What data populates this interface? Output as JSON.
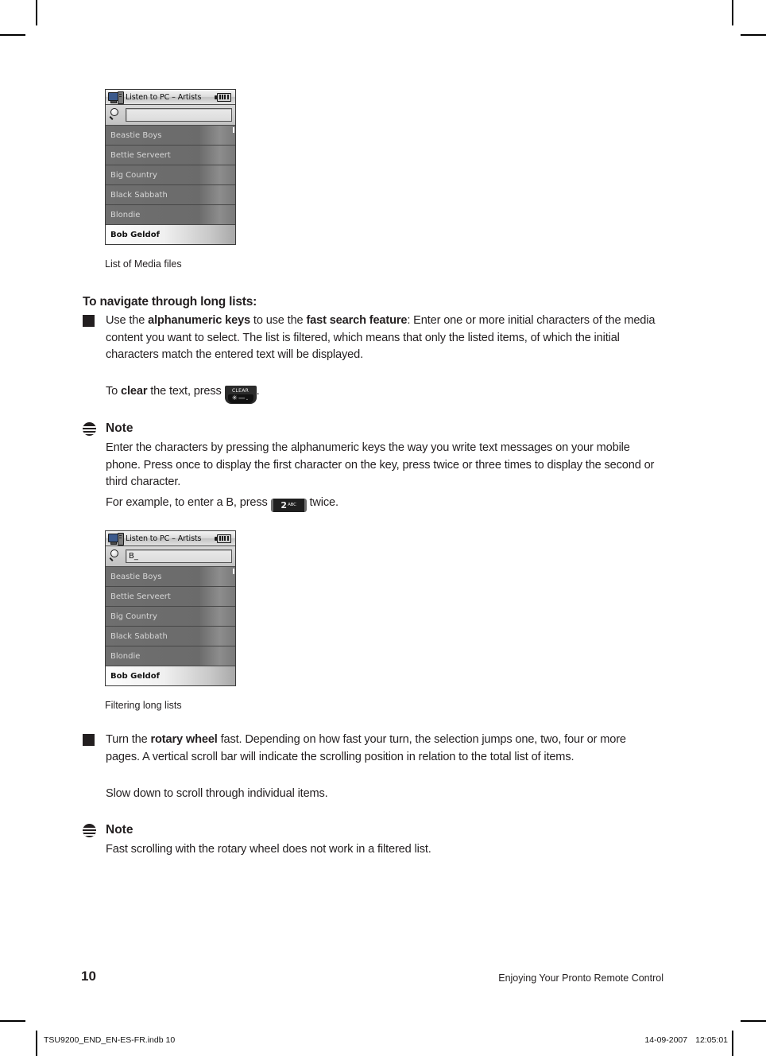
{
  "page": {
    "number": "10",
    "running_head": "Enjoying Your Pronto Remote Control",
    "slug_file": "TSU9200_END_EN-ES-FR.indb   10",
    "slug_date": "14-09-2007",
    "slug_time": "12:05:01"
  },
  "screenshot_1": {
    "title": "Listen to PC – Artists",
    "search_value": "",
    "items": [
      "Beastie Boys",
      "Bettie Serveert",
      "Big Country",
      "Black Sabbath",
      "Blondie",
      "Bob Geldof"
    ],
    "selected_item": "Bob Geldof",
    "caption": "List of Media files"
  },
  "screenshot_2": {
    "title": "Listen to PC – Artists",
    "search_value": "B_",
    "items": [
      "Beastie Boys",
      "Bettie Serveert",
      "Big Country",
      "Black Sabbath",
      "Blondie",
      "Bob Geldof"
    ],
    "selected_item": "Bob Geldof",
    "caption": "Filtering long lists"
  },
  "section": {
    "heading": "To navigate through long lists:"
  },
  "bullet_1": {
    "part_1": "Use the ",
    "bold_1": "alphanumeric keys",
    "part_2": " to use the ",
    "bold_2": "fast search feature",
    "part_3": ": Enter one or more initial characters of the media content you want to select. The list is filtered, which means that only the listed items, of which the initial characters match the entered text will be displayed.",
    "clear_line_pre": "To ",
    "clear_line_bold": "clear",
    "clear_line_mid": " the text, press ",
    "clear_line_post": "."
  },
  "key_clear": {
    "label": "CLEAR",
    "glyphs": "✳—."
  },
  "key_two": {
    "number": "2",
    "letters": "ABC"
  },
  "note_1": {
    "label": "Note",
    "text": "Enter the characters by pressing the alphanumeric keys the way you write text messages on your mobile phone. Press once to display the first character on the key, press twice or three times to display the second or third character.",
    "example_pre": "For example, to enter a B, press ",
    "example_post": " twice."
  },
  "bullet_2": {
    "part_1": "Turn the ",
    "bold_1": "rotary wheel",
    "part_2": " fast. Depending on how fast your turn, the selection jumps one, two, four or more pages. A vertical scroll bar will indicate the scrolling position in relation to the total list of items.",
    "line_2": "Slow down to scroll through individual items."
  },
  "note_2": {
    "label": "Note",
    "text": "Fast scrolling with the rotary wheel does not work in a filtered list."
  }
}
